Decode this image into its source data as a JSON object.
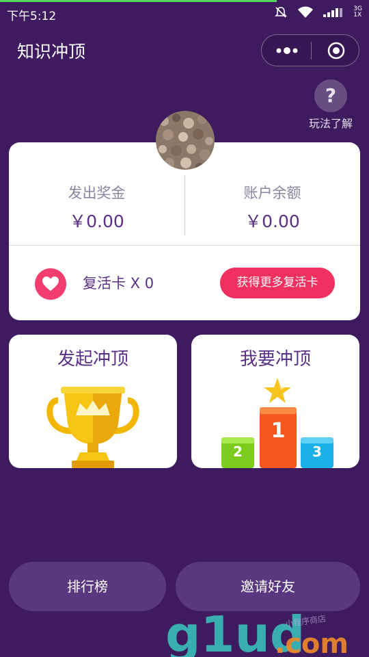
{
  "status_bar": {
    "time": "下午5:12",
    "network_top": "3G",
    "network_bottom": "1X"
  },
  "nav": {
    "title": "知识冲顶"
  },
  "help": {
    "icon_glyph": "?",
    "label": "玩法了解"
  },
  "account": {
    "prize_label": "发出奖金",
    "prize_value": "￥0.00",
    "balance_label": "账户余额",
    "balance_value": "￥0.00",
    "revive_text": "复活卡 X 0",
    "get_more_label": "获得更多复活卡"
  },
  "features": {
    "start": {
      "title": "发起冲顶"
    },
    "join": {
      "title": "我要冲顶",
      "podium": [
        "2",
        "1",
        "3"
      ]
    }
  },
  "bottom": {
    "leaderboard_label": "排行榜",
    "invite_label": "邀请好友"
  },
  "watermark": {
    "brand": "g1ud",
    "domain": ".com",
    "tagline": "小程序商店"
  },
  "colors": {
    "background": "#3e1b5f",
    "accent": "#f0305e",
    "text_purple": "#5a2f86",
    "button_bg": "#5a3880"
  }
}
